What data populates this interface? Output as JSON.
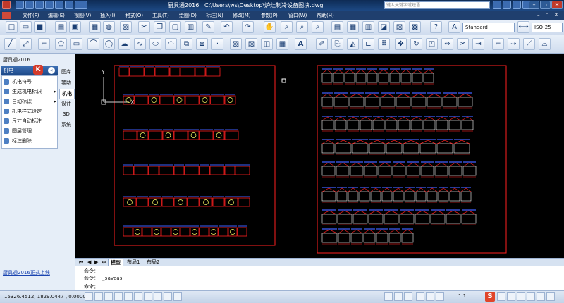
{
  "window": {
    "app_name": "厨具通2016",
    "file_path": "C:\\Users\\ws\\Desktop\\炉灶制冷设备图块.dwg",
    "search_placeholder": "键入关键字或短语"
  },
  "menu": [
    "文件(F)",
    "编辑(E)",
    "视图(V)",
    "插入(I)",
    "格式(O)",
    "工具(T)",
    "绘图(D)",
    "标注(N)",
    "修改(M)",
    "参数(P)",
    "窗口(W)",
    "帮助(H)"
  ],
  "toolbar": {
    "text_style": "Standard",
    "dim_style": "ISO-25",
    "row1_icons": [
      "new-icon",
      "open-icon",
      "save-icon",
      "print-icon",
      "print-preview-icon",
      "publish-icon",
      "3d-print-icon",
      "cut-icon",
      "copy-icon",
      "paste-icon",
      "match-properties-icon",
      "block-editor-icon",
      "undo-icon",
      "redo-icon",
      "pan-icon",
      "zoom-realtime-icon",
      "zoom-window-icon",
      "zoom-previous-icon",
      "properties-icon",
      "design-center-icon",
      "tool-palettes-icon",
      "sheet-set-icon",
      "markup-icon",
      "quickcalc-icon",
      "help-icon",
      "text-style-icon",
      "dim-style-icon"
    ],
    "row2_icons": [
      "line-icon",
      "construction-line-icon",
      "polyline-icon",
      "polygon-icon",
      "rectangle-icon",
      "arc-icon",
      "circle-icon",
      "revision-cloud-icon",
      "spline-icon",
      "ellipse-icon",
      "ellipse-arc-icon",
      "insert-block-icon",
      "make-block-icon",
      "point-icon",
      "hatch-icon",
      "gradient-icon",
      "region-icon",
      "table-icon",
      "mtext-icon",
      "erase-icon",
      "copy-object-icon",
      "mirror-icon",
      "offset-icon",
      "array-icon",
      "move-icon",
      "rotate-icon",
      "scale-icon",
      "stretch-icon",
      "trim-icon",
      "extend-icon",
      "break-icon",
      "join-icon",
      "chamfer-icon"
    ]
  },
  "left_panel": {
    "title": "厨具通2016",
    "header": "机电",
    "items": [
      "机电符号",
      "生成机电标识",
      "自动标识",
      "机电样式设定",
      "尺寸自动标注",
      "图层管理",
      "标注删除"
    ],
    "tabs": [
      "图库",
      "辅助",
      "机电",
      "设计",
      "3D",
      "系统"
    ],
    "active_tab": "机电",
    "footer_link": "厨具通2016正式上线"
  },
  "canvas": {
    "ucs_y_label": "Y",
    "ucs_x_label": "X"
  },
  "layout_tabs": [
    "模型",
    "布局1",
    "布局2"
  ],
  "command": {
    "lines": [
      "命令：",
      "命令：  _saveas"
    ],
    "prompt": "命令："
  },
  "status": {
    "coords": "15326.4512, 1829.0447  , 0.0000",
    "scale": "1:1"
  },
  "colors": {
    "canvas_bg": "#000000",
    "frame_red": "#ff2020",
    "block_blue": "#4060ff",
    "accent_red": "#e02020"
  }
}
